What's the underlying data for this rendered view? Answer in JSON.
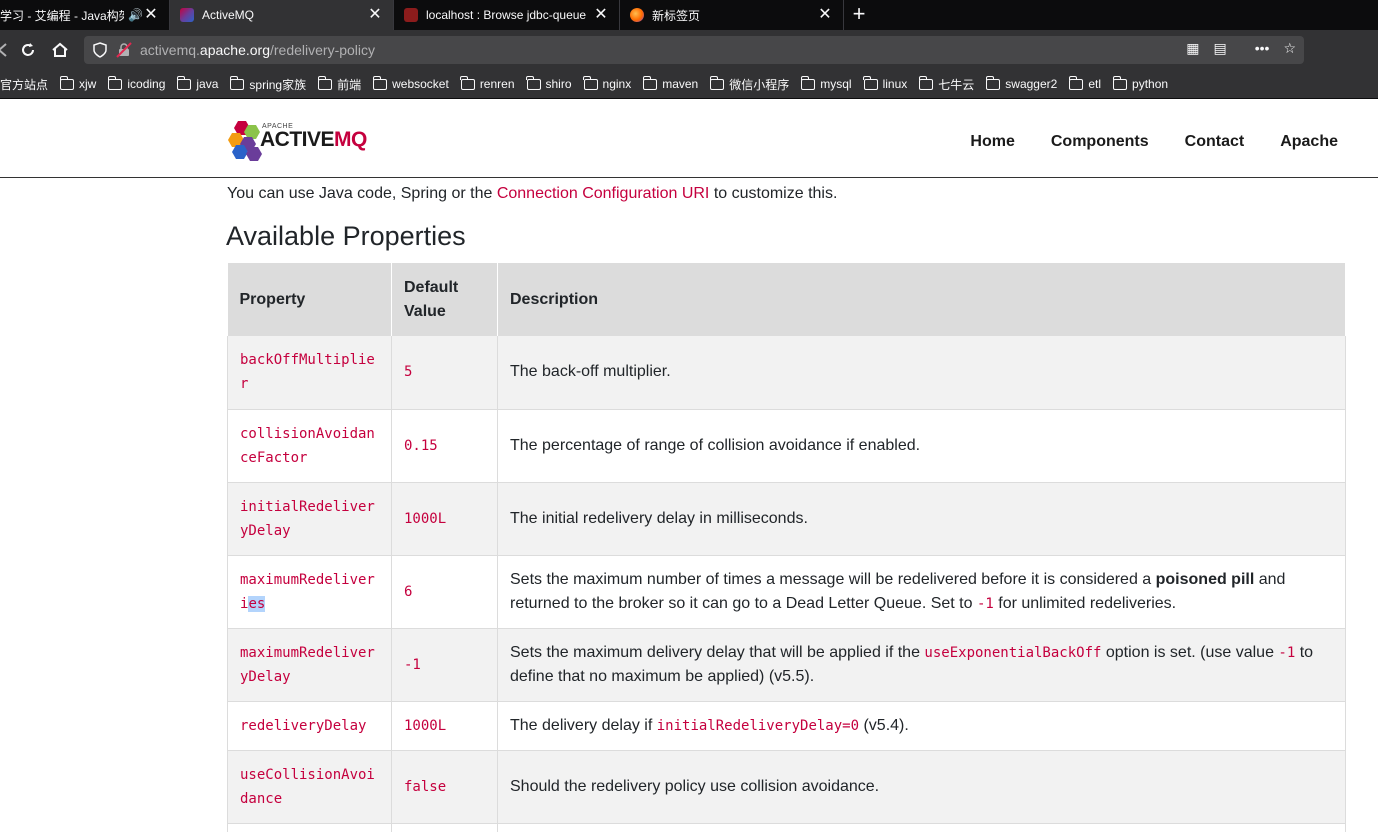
{
  "browser": {
    "tabs": [
      {
        "title": "学习 - 艾编程 - Java构架",
        "active": false,
        "audio": true
      },
      {
        "title": "ActiveMQ",
        "active": true,
        "audio": false
      },
      {
        "title": "localhost : Browse jdbc-queue",
        "active": false,
        "audio": false
      },
      {
        "title": "新标签页",
        "active": false,
        "audio": false
      }
    ],
    "url_prefix": "activemq.",
    "url_domain": "apache.org",
    "url_path": "/redelivery-policy",
    "bookmarks": [
      "官方站点",
      "xjw",
      "icoding",
      "java",
      "spring家族",
      "前端",
      "websocket",
      "renren",
      "shiro",
      "nginx",
      "maven",
      "微信小程序",
      "mysql",
      "linux",
      "七牛云",
      "swagger2",
      "etl",
      "python"
    ]
  },
  "site": {
    "logo_small": "APACHE",
    "logo_main": "ACTIVE",
    "logo_accent": "MQ",
    "nav": [
      "Home",
      "Components",
      "Contact",
      "Apache"
    ]
  },
  "content": {
    "intro_before": "You can use Java code, Spring or the ",
    "intro_link": "Connection Configuration URI",
    "intro_after": " to customize this.",
    "heading": "Available Properties",
    "columns": [
      "Property",
      "Default Value",
      "Description"
    ],
    "rows": [
      {
        "property": "backOffMultiplier",
        "default": "5",
        "description": "The back-off multiplier."
      },
      {
        "property": "collisionAvoidanceFactor",
        "default": "0.15",
        "description": "The percentage of range of collision avoidance if enabled."
      },
      {
        "property": "initialRedeliveryDelay",
        "default": "1000L",
        "description": "The initial redelivery delay in milliseconds."
      },
      {
        "property": "maximumRedeliveries",
        "default": "6",
        "description_parts": [
          "Sets the maximum number of times a message will be redelivered before it is considered a ",
          "poisoned pill",
          " and returned to the broker so it can go to a Dead Letter Queue. Set to ",
          "-1",
          " for unlimited redeliveries."
        ]
      },
      {
        "property": "maximumRedeliveryDelay",
        "default": "-1",
        "description_parts": [
          "Sets the maximum delivery delay that will be applied if the ",
          "useExponentialBackOff",
          " option is set. (use value ",
          "-1",
          " to define that no maximum be applied) (v5.5)."
        ]
      },
      {
        "property": "redeliveryDelay",
        "default": "1000L",
        "description_parts": [
          "The delivery delay if ",
          "initialRedeliveryDelay=0",
          " (v5.4)."
        ]
      },
      {
        "property": "useCollisionAvoidance",
        "default": "false",
        "description": "Should the redelivery policy use collision avoidance."
      }
    ]
  }
}
